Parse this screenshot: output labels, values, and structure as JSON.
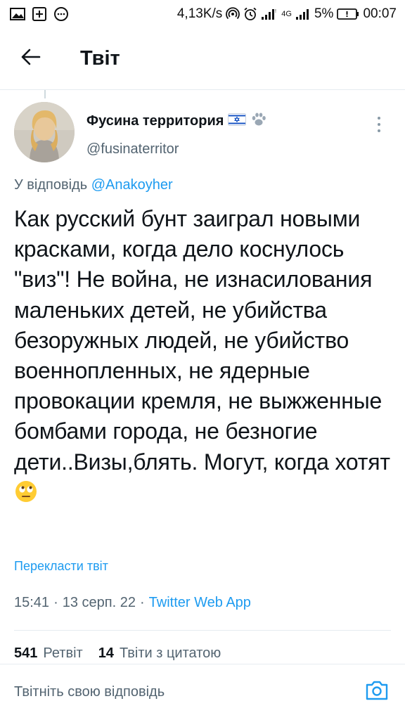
{
  "status_bar": {
    "speed": "4,13K/s",
    "network_4g": "4G",
    "battery": "5%",
    "time": "00:07",
    "icons": [
      "gallery-icon",
      "add-square-icon",
      "message-icon",
      "hotspot-icon",
      "alarm-icon",
      "signal-icon",
      "signal-4g-icon",
      "battery-icon"
    ]
  },
  "header": {
    "title": "Твіт",
    "back_icon": "arrow-left-icon"
  },
  "tweet": {
    "display_name": "Фусина территория",
    "flag_icon": "israel-flag-icon",
    "paw_icon": "paw-icon",
    "handle": "@fusinaterritor",
    "reply_prefix": "У відповідь",
    "reply_handle": "@Anakoyher",
    "text": "Как русский бунт заиграл новыми красками, когда дело коснулось \"виз\"! Не война, не изнасилования маленьких детей, не убийства безоружных людей, не убийство военнопленных, не ядерные провокации кремля, не выжженные бомбами города, не безногие дети..Визы,блять. Могут, когда хотят",
    "emoji": "eye-roll-emoji",
    "translate_label": "Перекласти твіт",
    "time": "15:41",
    "date": "13 серп. 22",
    "source": "Twitter Web App",
    "separator": "·"
  },
  "stats": {
    "retweets_count": "541",
    "retweets_label": "Ретвіт",
    "quotes_count": "14",
    "quotes_label": "Твіти з цитатою"
  },
  "reply_bar": {
    "placeholder": "Твітніть свою відповідь",
    "camera_icon": "camera-icon"
  },
  "colors": {
    "accent": "#1d9bf0",
    "text": "#0f1419",
    "secondary": "#536471"
  }
}
